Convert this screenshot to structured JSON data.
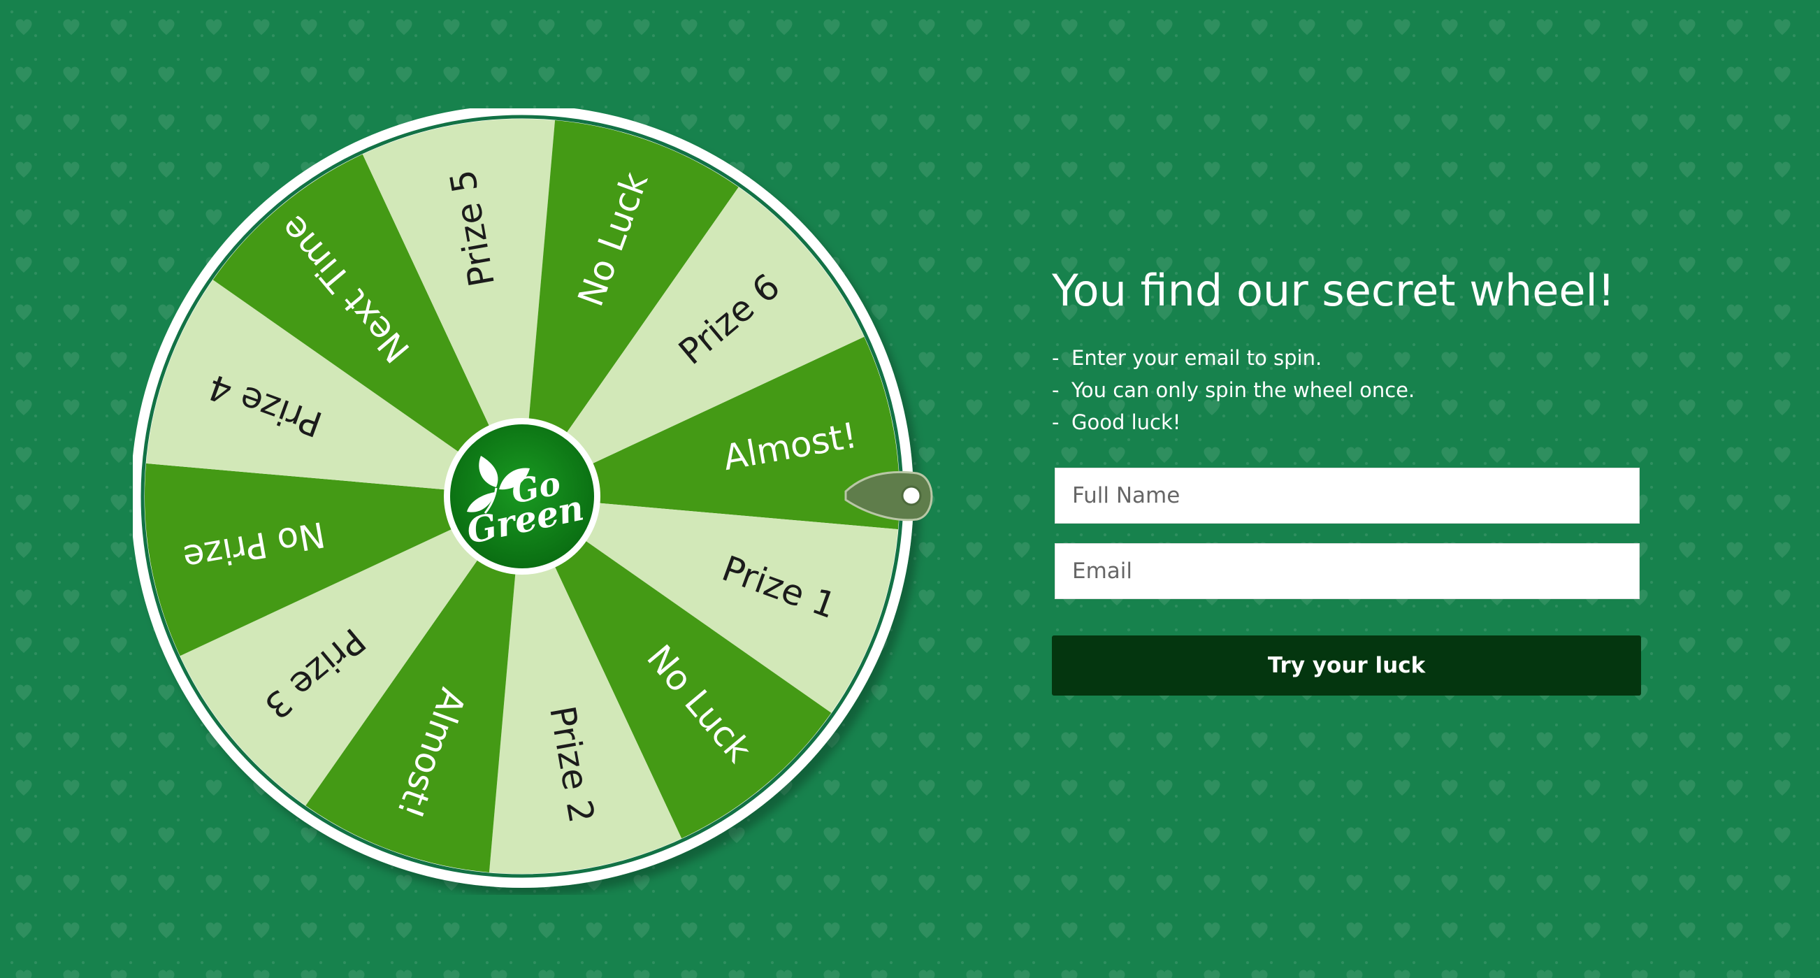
{
  "colors": {
    "background": "#17824d",
    "segment_dark": "#449a15",
    "segment_light": "#d2e8b8",
    "wheel_rim": "#ffffff",
    "wheel_border": "#127245",
    "pointer": "#5f7d4b",
    "button_bg": "#04360f",
    "logo_bg": "#107f1c"
  },
  "wheel": {
    "logo_line1": "Go",
    "logo_line2": "Green",
    "logo_icon": "leaves-icon",
    "segments": [
      {
        "label": "Almost!",
        "color": "dark"
      },
      {
        "label": "Prize 1",
        "color": "light"
      },
      {
        "label": "No Luck",
        "color": "dark"
      },
      {
        "label": "Prize 2",
        "color": "light"
      },
      {
        "label": "Almost!",
        "color": "dark"
      },
      {
        "label": "Prize 3",
        "color": "light"
      },
      {
        "label": "No Prize",
        "color": "dark"
      },
      {
        "label": "Prize 4",
        "color": "light"
      },
      {
        "label": "Next Time",
        "color": "dark"
      },
      {
        "label": "Prize 5",
        "color": "light"
      },
      {
        "label": "No Luck",
        "color": "dark"
      },
      {
        "label": "Prize 6",
        "color": "light"
      }
    ]
  },
  "panel": {
    "title": "You find our secret wheel!",
    "rules": [
      {
        "dash": "-",
        "text": "Enter your email to spin."
      },
      {
        "dash": "-",
        "text": "You can only spin the wheel once."
      },
      {
        "dash": "-",
        "text": "Good luck!"
      }
    ],
    "name_placeholder": "Full Name",
    "email_placeholder": "Email",
    "submit_label": "Try your luck"
  }
}
